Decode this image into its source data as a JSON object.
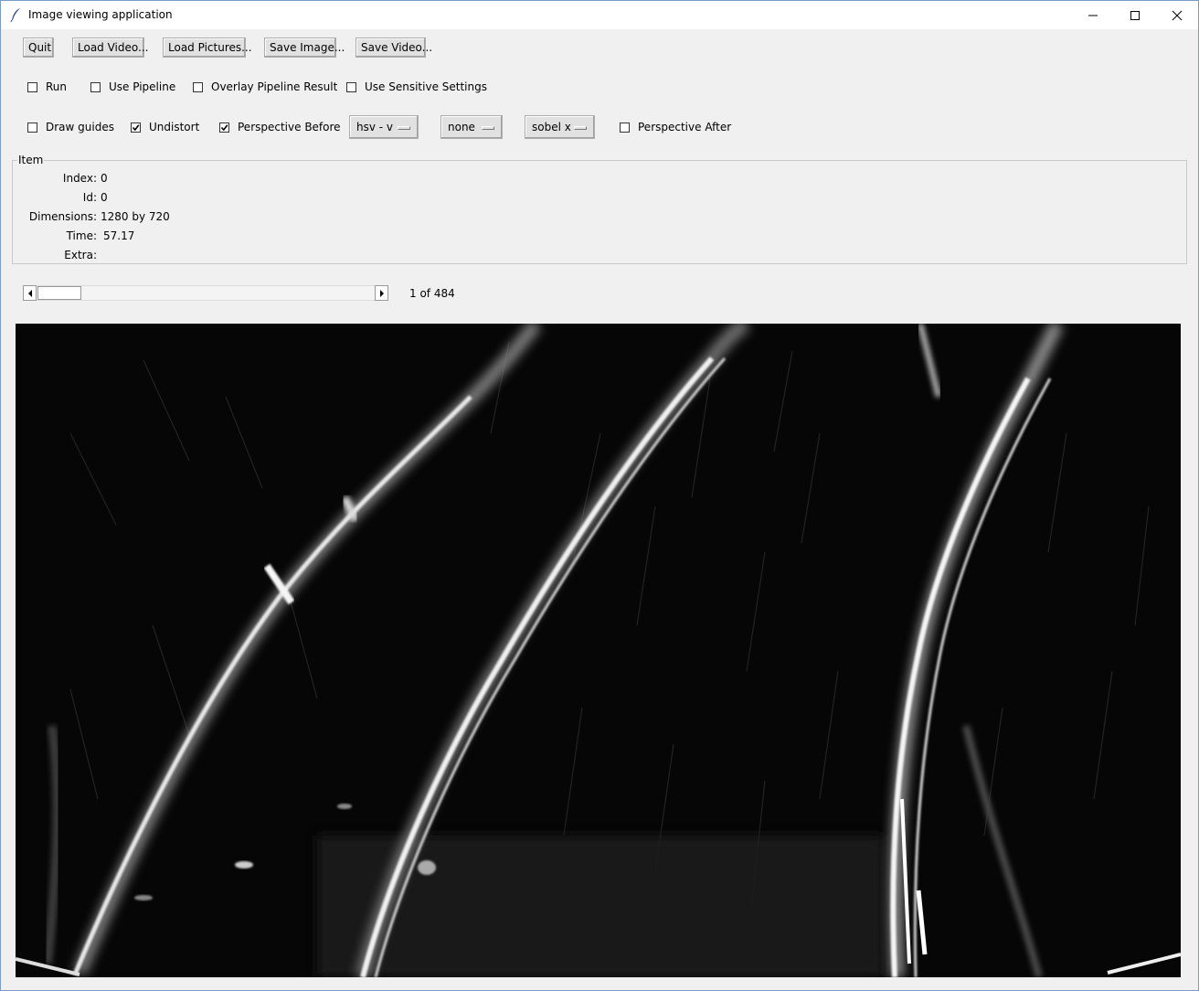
{
  "window": {
    "title": "Image viewing application",
    "controls": [
      "minimize-icon",
      "maximize-icon",
      "close-icon"
    ]
  },
  "toolbar": {
    "quit": "Quit",
    "load_video": "Load Video...",
    "load_pictures": "Load Pictures...",
    "save_image": "Save Image...",
    "save_video": "Save Video..."
  },
  "options_row1": {
    "run": {
      "label": "Run",
      "checked": false
    },
    "use_pipeline": {
      "label": "Use Pipeline",
      "checked": false
    },
    "overlay": {
      "label": "Overlay Pipeline Result",
      "checked": false
    },
    "sensitive": {
      "label": "Use Sensitive Settings",
      "checked": false
    }
  },
  "options_row2": {
    "draw_guides": {
      "label": "Draw guides",
      "checked": false
    },
    "undistort": {
      "label": "Undistort",
      "checked": true
    },
    "perspective_before": {
      "label": "Perspective Before",
      "checked": true
    },
    "colorspace": "hsv - v",
    "filter": "none",
    "edge": "sobel x",
    "perspective_after": {
      "label": "Perspective After",
      "checked": false
    }
  },
  "item": {
    "group_label": "Item",
    "index_label": "Index:",
    "index_value": "0",
    "id_label": "Id:",
    "id_value": "0",
    "dimensions_label": "Dimensions:",
    "dimensions_value": "1280 by 720",
    "time_label": "Time:",
    "time_value": "57.17",
    "extra_label": "Extra:",
    "extra_value": ""
  },
  "navigator": {
    "position_text": "1 of 484",
    "current_frame": 1,
    "total_frames": 484
  },
  "image": {
    "description_icon": "lane-edge-image"
  }
}
